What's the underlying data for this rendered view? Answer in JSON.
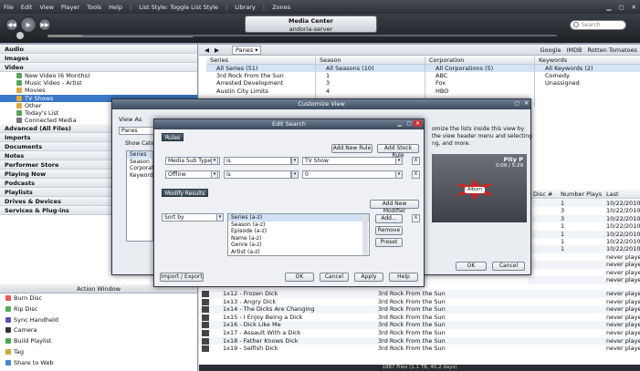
{
  "menu": [
    "File",
    "Edit",
    "View",
    "Player",
    "Tools",
    "Help"
  ],
  "toolbar_items": {
    "list_style": "List Style: Toggle List Style",
    "library": "Library",
    "zones": "Zones"
  },
  "player": {
    "title": "Media Center",
    "subtitle": "andoria-server",
    "search_placeholder": "Search"
  },
  "tree": [
    {
      "label": "Audio",
      "level": 0
    },
    {
      "label": "Images",
      "level": 0
    },
    {
      "label": "Video",
      "level": 0
    },
    {
      "label": "New Video (6 Months)",
      "level": 1,
      "color": "#5aa25a"
    },
    {
      "label": "Music Video - Artist",
      "level": 1,
      "color": "#5aa25a"
    },
    {
      "label": "Movies",
      "level": 1,
      "color": "#e0a83a"
    },
    {
      "label": "TV Shows",
      "level": 1,
      "color": "#e0a83a",
      "selected": true
    },
    {
      "label": "Other",
      "level": 1,
      "color": "#e0a83a"
    },
    {
      "label": "Today's List",
      "level": 1,
      "color": "#5aa25a"
    },
    {
      "label": "Connected Media",
      "level": 1,
      "color": "#777777"
    },
    {
      "label": "Advanced (All Files)",
      "level": 0
    },
    {
      "label": "Imports",
      "level": 0
    },
    {
      "label": "Documents",
      "level": 0
    },
    {
      "label": "Notes",
      "level": 0
    },
    {
      "label": "Performer Store",
      "level": 0
    },
    {
      "label": "Playing Now",
      "level": 0
    },
    {
      "label": "Podcasts",
      "level": 0
    },
    {
      "label": "Playlists",
      "level": 0
    },
    {
      "label": "Drives & Devices",
      "level": 0
    },
    {
      "label": "Services & Plug-ins",
      "level": 0
    }
  ],
  "action_window": {
    "title": "Action Window",
    "items": [
      "Burn Disc",
      "Rip Disc",
      "Sync Handheld",
      "Camera",
      "Build Playlist",
      "Tag",
      "Share to Web"
    ]
  },
  "panes_bar": {
    "panes_label": "Panes",
    "links": [
      "Google",
      "IMDB",
      "Rotten Tomatoes"
    ]
  },
  "columns": [
    {
      "header": "Series",
      "items": [
        "All Series (51)",
        "3rd Rock From the Sun",
        "Arrested Development",
        "Austin City Limits"
      ]
    },
    {
      "header": "Season",
      "items": [
        "All Seasons (10)",
        "1",
        "3",
        "4"
      ]
    },
    {
      "header": "Corporation",
      "items": [
        "All Corporations (5)",
        "ABC",
        "Fox",
        "HBO"
      ]
    },
    {
      "header": "Keywords",
      "items": [
        "All Keywords (2)",
        "Comedy",
        "Unassigned"
      ]
    }
  ],
  "file_list": {
    "headers": {
      "disc": "Disc #",
      "plays": "Number Plays",
      "last": "Last Played"
    },
    "top_rows": [
      {
        "plays": "1",
        "last": "10/22/2010"
      },
      {
        "plays": "3",
        "last": "10/22/2010"
      },
      {
        "plays": "3",
        "last": "10/22/2010"
      },
      {
        "plays": "1",
        "last": "10/22/2010"
      },
      {
        "plays": "1",
        "last": "10/22/2010"
      },
      {
        "plays": "1",
        "last": "10/22/2010"
      },
      {
        "plays": "1",
        "last": "10/22/2010"
      },
      {
        "plays": "",
        "last": "never played"
      },
      {
        "plays": "",
        "last": "never played"
      },
      {
        "plays": "",
        "last": "never played"
      },
      {
        "plays": "",
        "last": "never played"
      }
    ],
    "rows": [
      {
        "name": "1x12 - Frozen Dick",
        "series": "3rd Rock From the Sun",
        "last": "never played"
      },
      {
        "name": "1x13 - Angry Dick",
        "series": "3rd Rock From the Sun",
        "last": "never played"
      },
      {
        "name": "1x14 - The Dicks Are Changing",
        "series": "3rd Rock From the Sun",
        "last": "never played"
      },
      {
        "name": "1x15 - I Enjoy Being a Dick",
        "series": "3rd Rock From the Sun",
        "last": "never played"
      },
      {
        "name": "1x16 - Dick Like Me",
        "series": "3rd Rock From the Sun",
        "last": "never played"
      },
      {
        "name": "1x17 - Assault With a Dick",
        "series": "3rd Rock From the Sun",
        "last": "never played"
      },
      {
        "name": "1x18 - Father Knows Dick",
        "series": "3rd Rock From the Sun",
        "last": "never played"
      },
      {
        "name": "1x19 - Selfish Dick",
        "series": "3rd Rock From the Sun",
        "last": "never played"
      }
    ],
    "status": "1887 Files (1.1 TB, 40.2 days)"
  },
  "customize_view": {
    "title": "Customize View",
    "view_as_label": "View As",
    "view_as_value": "Panes",
    "show_categories_label": "Show Categ",
    "categories": [
      "Series",
      "Season",
      "Corporat",
      "Keyword"
    ],
    "help_text_1": "omize the lists inside this view by",
    "help_text_2": "the view header menu and selecting",
    "help_text_3": "ng, and more.",
    "preview_label": "Pity P",
    "preview_time": "0:09 / 5:29",
    "preview_album": "Album",
    "ok": "OK",
    "cancel": "Cancel"
  },
  "edit_search": {
    "title": "Edit Search",
    "rules_header": "Rules",
    "add_new_rule": "Add New Rule",
    "add_stock_rule": "Add Stock Rule",
    "rules": [
      {
        "field": "Media Sub Type",
        "op": "is",
        "value": "TV Show"
      },
      {
        "field": "Offline",
        "op": "is",
        "value": "0"
      }
    ],
    "modify_header": "Modify Results",
    "add_new_modifier": "Add New Modifier",
    "sort_by": "Sort by",
    "sort_options": [
      "Series (a-z)",
      "Season (a-z)",
      "Episode (a-z)",
      "Name (a-z)",
      "Genre (a-z)",
      "Artist (a-z)"
    ],
    "add_btn": "Add...",
    "remove_btn": "Remove",
    "preset_btn": "Preset",
    "import_export": "Import / Export",
    "ok": "OK",
    "cancel": "Cancel",
    "apply": "Apply",
    "help": "Help",
    "x": "X"
  }
}
